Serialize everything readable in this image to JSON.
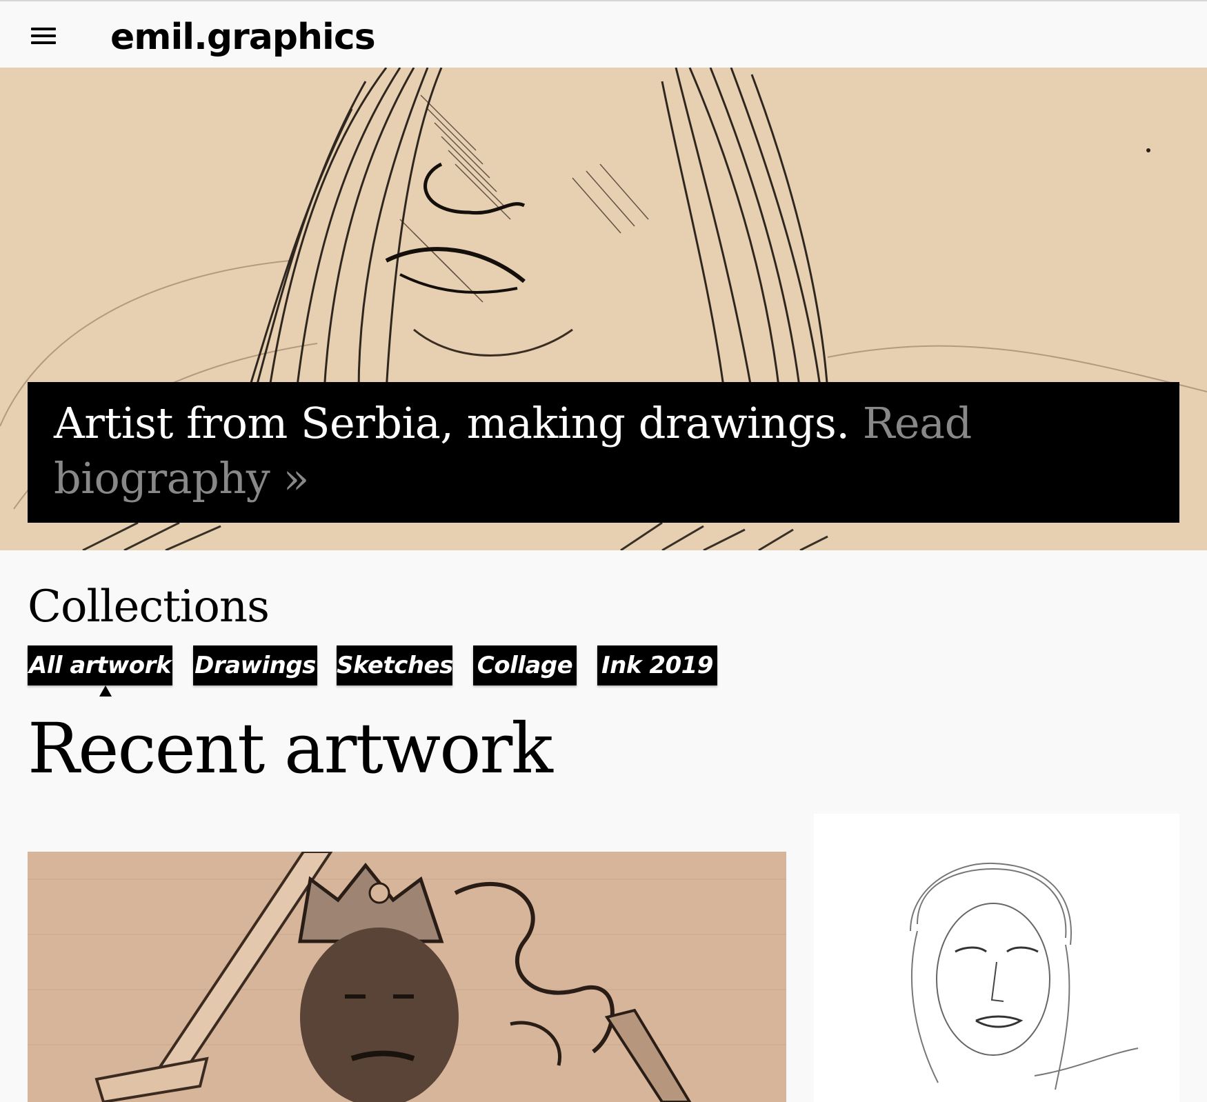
{
  "site": {
    "logo": "emil.graphics",
    "menu_icon": "hamburger-icon"
  },
  "hero": {
    "tagline": "Artist from Serbia, making drawings.",
    "link_label": "Read biography",
    "link_arrow": "»",
    "image_desc_icon": "ink-portrait-drawing"
  },
  "collections": {
    "title": "Collections",
    "tags": [
      {
        "label": "All artwork",
        "active": true
      },
      {
        "label": "Drawings",
        "active": false
      },
      {
        "label": "Sketches",
        "active": false
      },
      {
        "label": "Collage",
        "active": false
      },
      {
        "label": "Ink 2019",
        "active": false
      }
    ]
  },
  "recent": {
    "title": "Recent artwork"
  },
  "colors": {
    "paper": "#e7cfb1",
    "banner": "#000000",
    "link_grey": "#888888",
    "background": "#f9f9f9"
  }
}
